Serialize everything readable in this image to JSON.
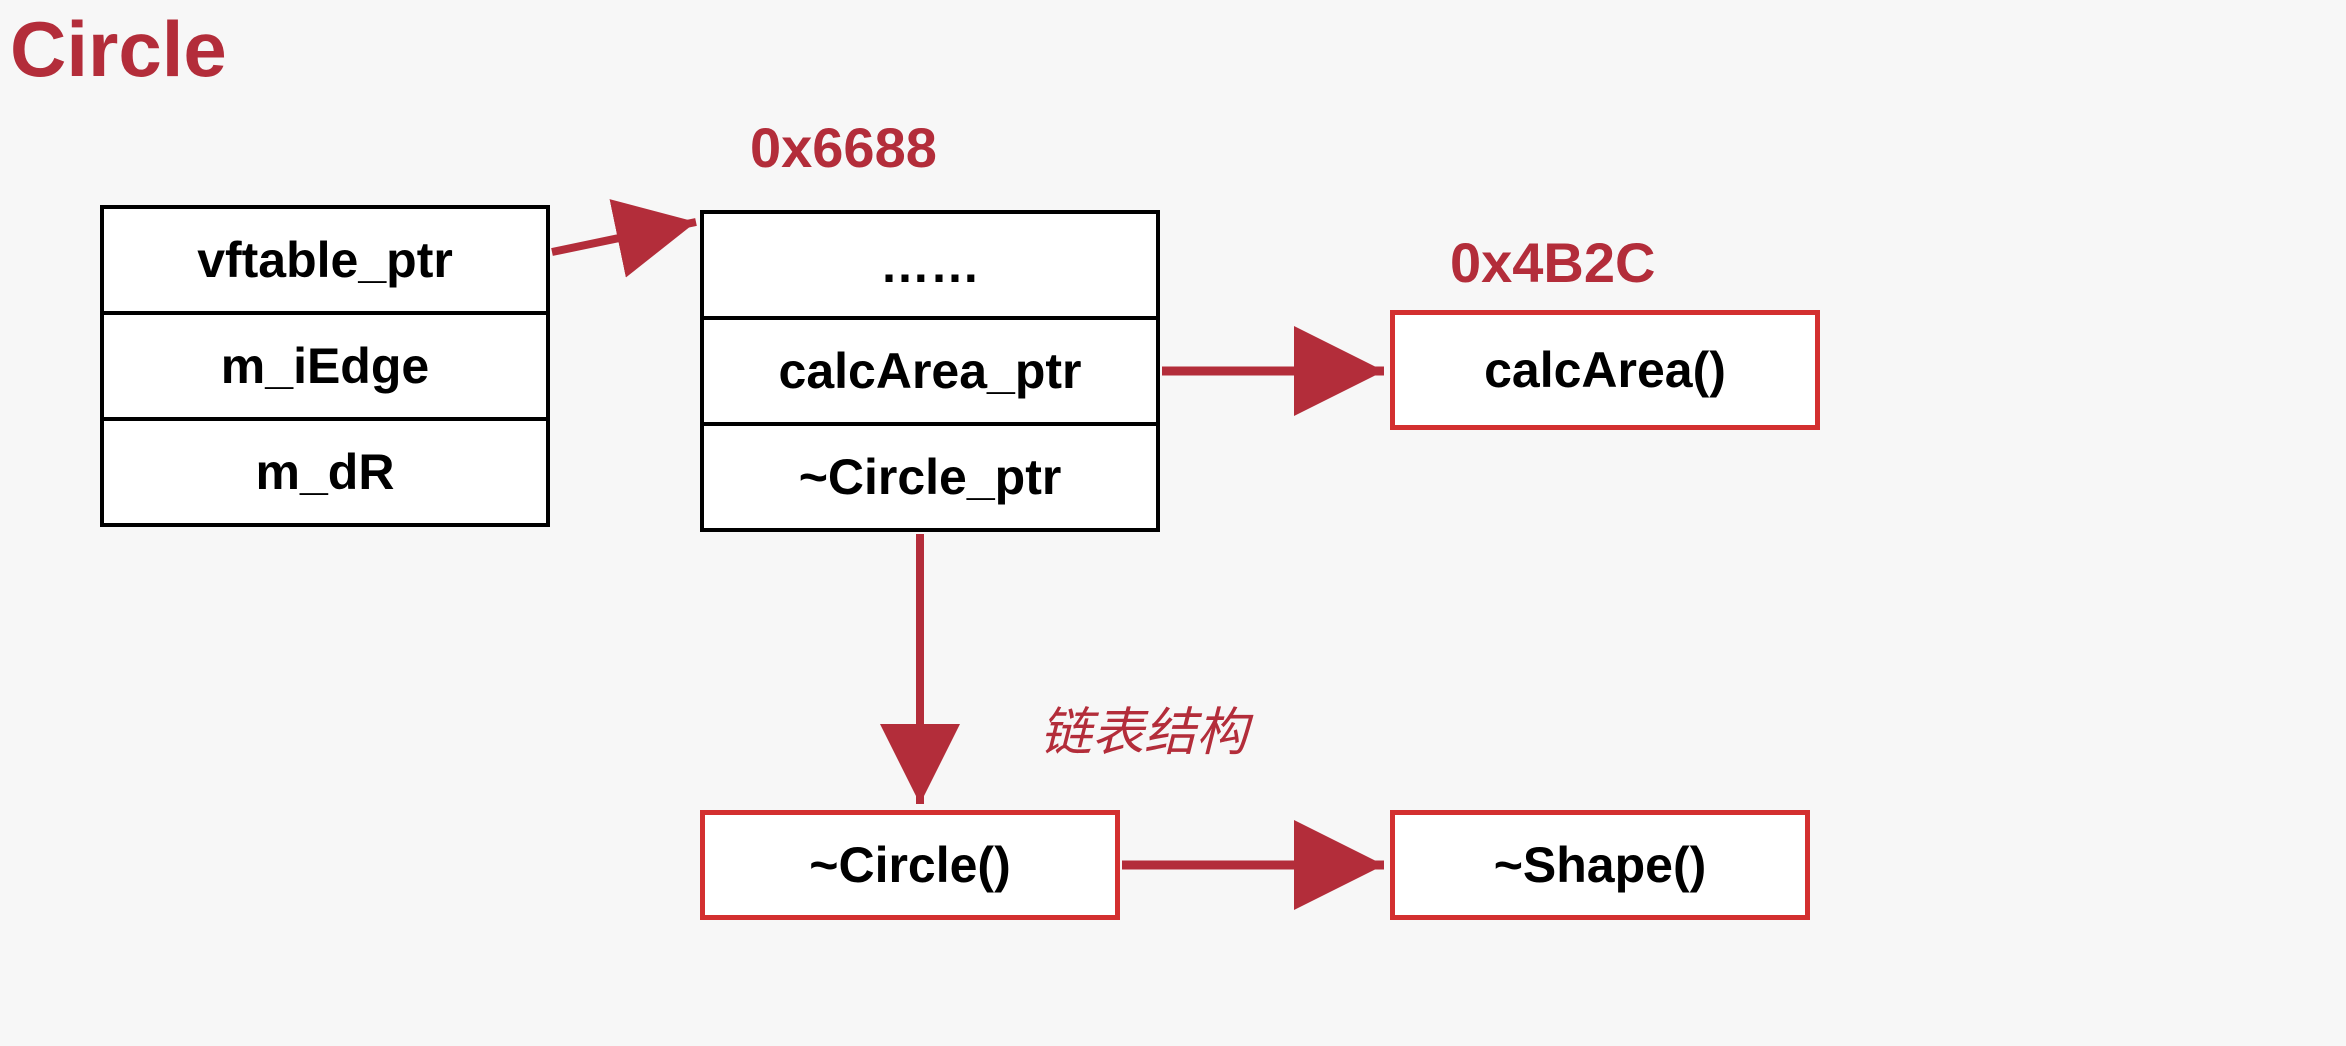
{
  "title": "Circle",
  "object_table": {
    "rows": [
      "vftable_ptr",
      "m_iEdge",
      "m_dR"
    ]
  },
  "vtable": {
    "address": "0x6688",
    "rows": [
      "……",
      "calcArea_ptr",
      "~Circle_ptr"
    ]
  },
  "calcArea": {
    "address": "0x4B2C",
    "label": "calcArea()"
  },
  "dtor_circle": {
    "label": "~Circle()"
  },
  "dtor_shape": {
    "label": "~Shape()"
  },
  "annotation": "链表结构"
}
